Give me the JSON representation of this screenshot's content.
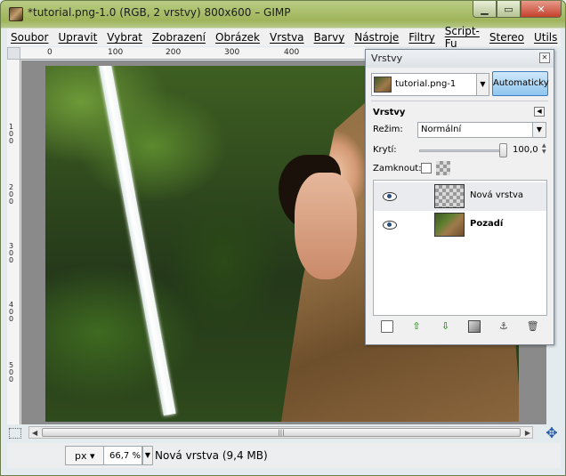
{
  "window": {
    "title": "*tutorial.png-1.0 (RGB, 2 vrstvy) 800x600 – GIMP",
    "min_label": "▁",
    "max_label": "▭",
    "close_label": "✕"
  },
  "menu": [
    "Soubor",
    "Upravit",
    "Vybrat",
    "Zobrazení",
    "Obrázek",
    "Vrstva",
    "Barvy",
    "Nástroje",
    "Filtry",
    "Script-Fu",
    "Stereo",
    "Utils"
  ],
  "rulers": {
    "top": [
      "0",
      "100",
      "200",
      "300",
      "400"
    ],
    "left": [
      "1\n0\n0",
      "2\n0\n0",
      "3\n0\n0",
      "4\n0\n0",
      "5\n0\n0"
    ]
  },
  "statusbar": {
    "unit": "px",
    "zoom": "66,7 %",
    "status": "Nová vrstva (9,4 MB)"
  },
  "layers_dock": {
    "title": "Vrstvy",
    "image_name": "tutorial.png-1",
    "auto_button": "Automaticky",
    "section_title": "Vrstvy",
    "mode_label": "Režim:",
    "mode_value": "Normální",
    "opacity_label": "Krytí:",
    "opacity_value": "100,0",
    "lock_label": "Zamknout:",
    "layers": [
      {
        "name": "Nová vrstva",
        "visible": true,
        "selected": true,
        "bold": false
      },
      {
        "name": "Pozadí",
        "visible": true,
        "selected": false,
        "bold": true
      }
    ]
  }
}
